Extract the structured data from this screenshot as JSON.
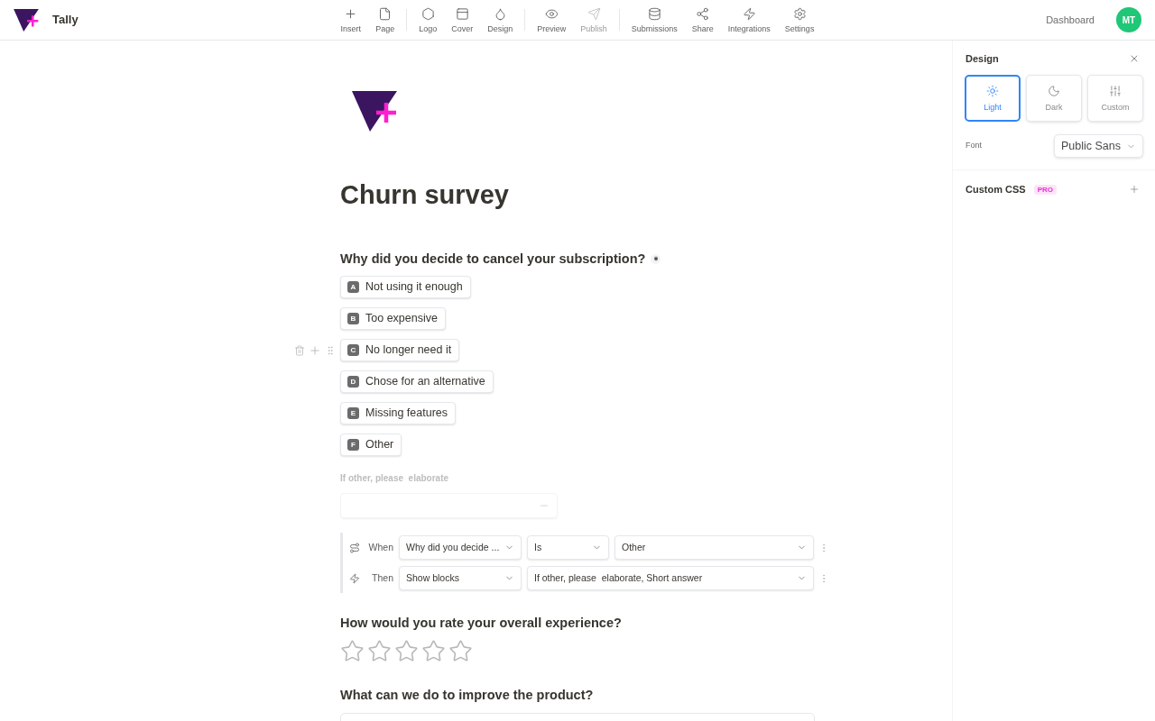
{
  "header": {
    "brand": "Tally",
    "toolbar_groups": [
      {
        "items": [
          {
            "label": "Insert",
            "disabled": false
          },
          {
            "label": "Page",
            "disabled": false
          }
        ]
      },
      {
        "items": [
          {
            "label": "Logo",
            "disabled": false
          },
          {
            "label": "Cover",
            "disabled": false
          },
          {
            "label": "Design",
            "disabled": false
          }
        ]
      },
      {
        "items": [
          {
            "label": "Preview",
            "disabled": false
          },
          {
            "label": "Publish",
            "disabled": true
          }
        ]
      },
      {
        "items": [
          {
            "label": "Submissions",
            "disabled": false
          },
          {
            "label": "Share",
            "disabled": false
          },
          {
            "label": "Integrations",
            "disabled": false
          },
          {
            "label": "Settings",
            "disabled": false
          }
        ]
      }
    ],
    "dashboard_link": "Dashboard",
    "avatar": "MT"
  },
  "form": {
    "title": "Churn survey",
    "blocks": [
      {
        "kind": "choice",
        "question": "Why did you decide to cancel your subscription?",
        "required": true,
        "options": [
          {
            "key": "A",
            "label": "Not using it enough",
            "hovered": false
          },
          {
            "key": "B",
            "label": "Too expensive",
            "hovered": false
          },
          {
            "key": "C",
            "label": "No longer need it",
            "hovered": true
          },
          {
            "key": "D",
            "label": "Chose for an alternative",
            "hovered": false
          },
          {
            "key": "E",
            "label": "Missing features",
            "hovered": false
          },
          {
            "key": "F",
            "label": "Other",
            "hovered": false
          }
        ]
      },
      {
        "kind": "short_answer",
        "label": "If other, please  elaborate",
        "conditional": true
      },
      {
        "kind": "logic",
        "rows": [
          {
            "label": "When",
            "selects": [
              "Why did you decide ...",
              "Is",
              "Other"
            ]
          },
          {
            "label": "Then",
            "selects": [
              "Show blocks",
              "If other, please  elaborate, Short answer"
            ]
          }
        ]
      },
      {
        "kind": "rating",
        "question": "How would you rate your overall experience?",
        "stars": 0
      },
      {
        "kind": "long_answer",
        "question": "What can we do to improve the product?"
      }
    ]
  },
  "design_panel": {
    "title": "Design",
    "themes": [
      {
        "label": "Light",
        "selected": true
      },
      {
        "label": "Dark",
        "selected": false
      },
      {
        "label": "Custom",
        "selected": false
      }
    ],
    "font": {
      "label": "Font",
      "value": "Public Sans"
    },
    "custom_css": {
      "label": "Custom CSS",
      "badge": "PRO"
    }
  }
}
